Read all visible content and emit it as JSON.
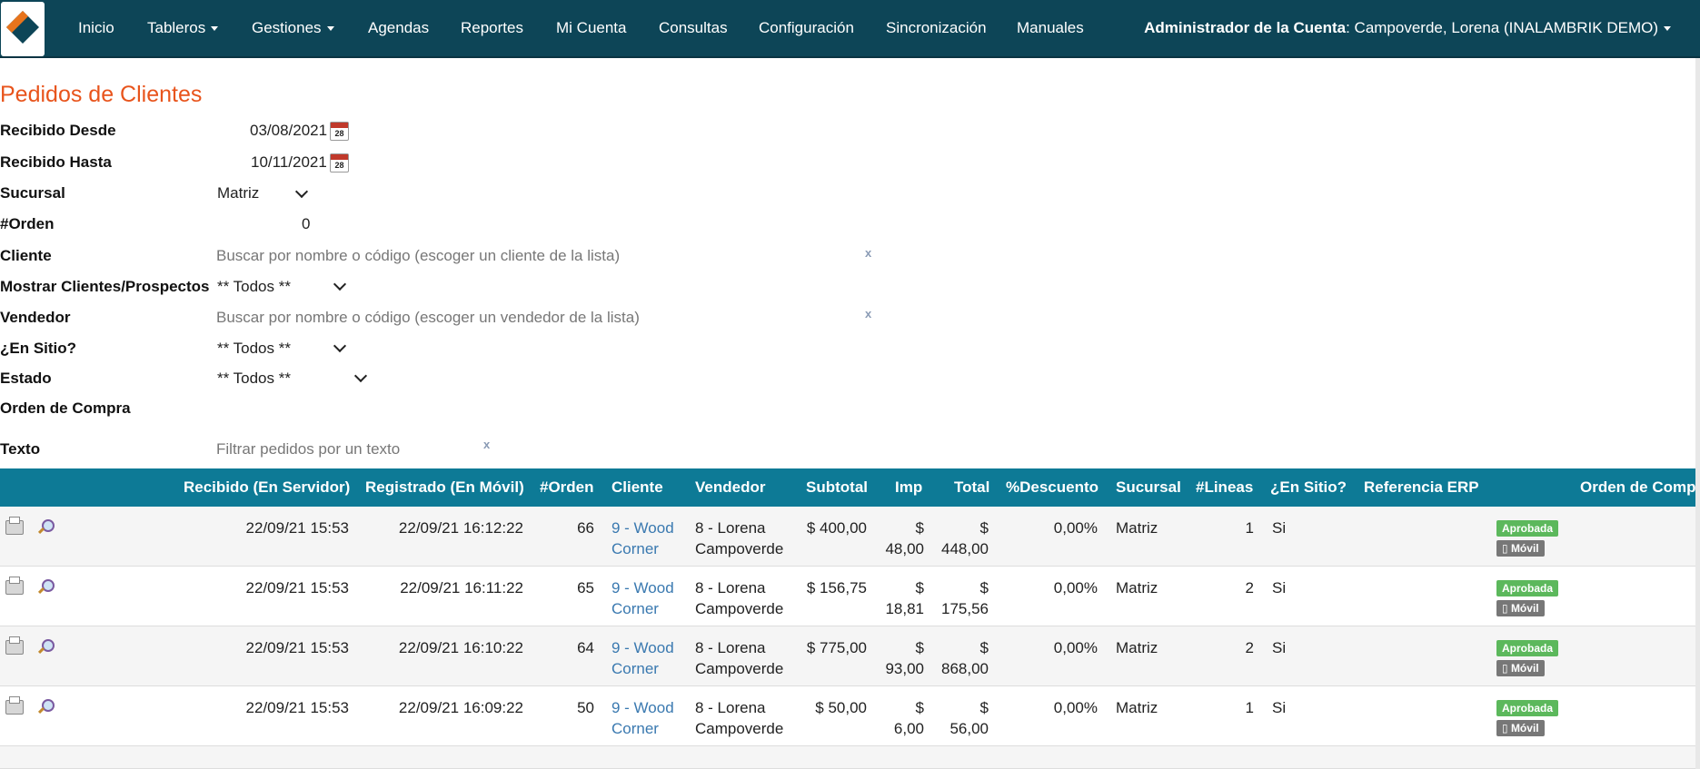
{
  "navbar": {
    "items": [
      {
        "label": "Inicio",
        "dropdown": false
      },
      {
        "label": "Tableros",
        "dropdown": true
      },
      {
        "label": "Gestiones",
        "dropdown": true
      },
      {
        "label": "Agendas",
        "dropdown": false
      },
      {
        "label": "Reportes",
        "dropdown": false
      },
      {
        "label": "Mi Cuenta",
        "dropdown": false
      },
      {
        "label": "Consultas",
        "dropdown": false
      },
      {
        "label": "Configuración",
        "dropdown": false
      },
      {
        "label": "Sincronización",
        "dropdown": false
      },
      {
        "label": "Manuales",
        "dropdown": false
      }
    ],
    "admin_label": "Administrador de la Cuenta",
    "admin_value": ": Campoverde, Lorena (INALAMBRIK DEMO)"
  },
  "page_title": "Pedidos de Clientes",
  "filters": {
    "recibido_desde": {
      "label": "Recibido Desde",
      "value": "03/08/2021",
      "cal": "28"
    },
    "recibido_hasta": {
      "label": "Recibido Hasta",
      "value": "10/11/2021",
      "cal": "28"
    },
    "sucursal": {
      "label": "Sucursal",
      "value": "Matriz"
    },
    "orden": {
      "label": "#Orden",
      "value": "0"
    },
    "cliente": {
      "label": "Cliente",
      "placeholder": "Buscar por nombre o código (escoger un cliente de la lista)",
      "clear": "x"
    },
    "mostrar": {
      "label": "Mostrar Clientes/Prospectos",
      "value": "** Todos **"
    },
    "vendedor": {
      "label": "Vendedor",
      "placeholder": "Buscar por nombre o código (escoger un vendedor de la lista)",
      "clear": "x"
    },
    "en_sitio": {
      "label": "¿En Sitio?",
      "value": "** Todos **"
    },
    "estado": {
      "label": "Estado",
      "value": "** Todos **"
    },
    "orden_compra": {
      "label": "Orden de Compra"
    },
    "texto": {
      "label": "Texto",
      "placeholder": "Filtrar pedidos por un texto",
      "clear": "x"
    }
  },
  "table": {
    "headers": [
      "Recibido (En Servidor)",
      "Registrado (En Móvil)",
      "#Orden",
      "Cliente",
      "Vendedor",
      "Subtotal",
      "Imp",
      "Total",
      "%Descuento",
      "Sucursal",
      "#Lineas",
      "¿En Sitio?",
      "Referencia ERP",
      "Orden de Compra"
    ],
    "rows": [
      {
        "recibido": "22/09/21 15:53",
        "registrado": "22/09/21 16:12:22",
        "orden": "66",
        "cliente1": "9 - Wood",
        "cliente2": "Corner",
        "vendedor1": "8 - Lorena",
        "vendedor2": "Campoverde",
        "subtotal": "$ 400,00",
        "imp1": "$",
        "imp2": "48,00",
        "total1": "$",
        "total2": "448,00",
        "descuento": "0,00%",
        "sucursal": "Matriz",
        "lineas": "1",
        "en_sitio": "Si",
        "status": "Aprobada",
        "origen": "Móvil"
      },
      {
        "recibido": "22/09/21 15:53",
        "registrado": "22/09/21 16:11:22",
        "orden": "65",
        "cliente1": "9 - Wood",
        "cliente2": "Corner",
        "vendedor1": "8 - Lorena",
        "vendedor2": "Campoverde",
        "subtotal": "$ 156,75",
        "imp1": "$",
        "imp2": "18,81",
        "total1": "$",
        "total2": "175,56",
        "descuento": "0,00%",
        "sucursal": "Matriz",
        "lineas": "2",
        "en_sitio": "Si",
        "status": "Aprobada",
        "origen": "Móvil"
      },
      {
        "recibido": "22/09/21 15:53",
        "registrado": "22/09/21 16:10:22",
        "orden": "64",
        "cliente1": "9 - Wood",
        "cliente2": "Corner",
        "vendedor1": "8 - Lorena",
        "vendedor2": "Campoverde",
        "subtotal": "$ 775,00",
        "imp1": "$",
        "imp2": "93,00",
        "total1": "$",
        "total2": "868,00",
        "descuento": "0,00%",
        "sucursal": "Matriz",
        "lineas": "2",
        "en_sitio": "Si",
        "status": "Aprobada",
        "origen": "Móvil"
      },
      {
        "recibido": "22/09/21 15:53",
        "registrado": "22/09/21 16:09:22",
        "orden": "50",
        "cliente1": "9 - Wood",
        "cliente2": "Corner",
        "vendedor1": "8 - Lorena",
        "vendedor2": "Campoverde",
        "subtotal": "$ 50,00",
        "imp1": "$",
        "imp2": "6,00",
        "total1": "$",
        "total2": "56,00",
        "descuento": "0,00%",
        "sucursal": "Matriz",
        "lineas": "1",
        "en_sitio": "Si",
        "status": "Aprobada",
        "origen": "Móvil"
      }
    ]
  },
  "colors": {
    "navbar": "#0d4557",
    "table_header": "#0d7a96",
    "title": "#e8541c",
    "link": "#3a79b0",
    "approved": "#5cb85c"
  }
}
